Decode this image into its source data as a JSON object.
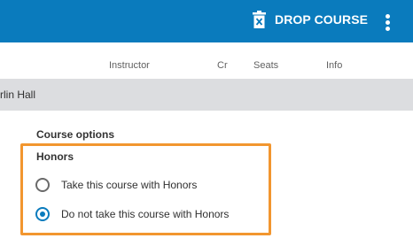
{
  "header": {
    "drop_course_label": "DROP COURSE",
    "drop_icon": "trash-icon",
    "menu_icon": "more-vertical-icon"
  },
  "columns": {
    "instructor": "Instructor",
    "credits": "Cr",
    "seats": "Seats",
    "info": "Info"
  },
  "section_row": {
    "location": "rlin Hall"
  },
  "course_options": {
    "title": "Course options",
    "group_label": "Honors",
    "options": [
      {
        "label": "Take this course with Honors",
        "selected": false
      },
      {
        "label": "Do not take this course with Honors",
        "selected": true
      }
    ]
  },
  "colors": {
    "header_bg": "#0a7bbd",
    "focus_outline": "#f2962f",
    "row_bg": "#dcdde0"
  }
}
